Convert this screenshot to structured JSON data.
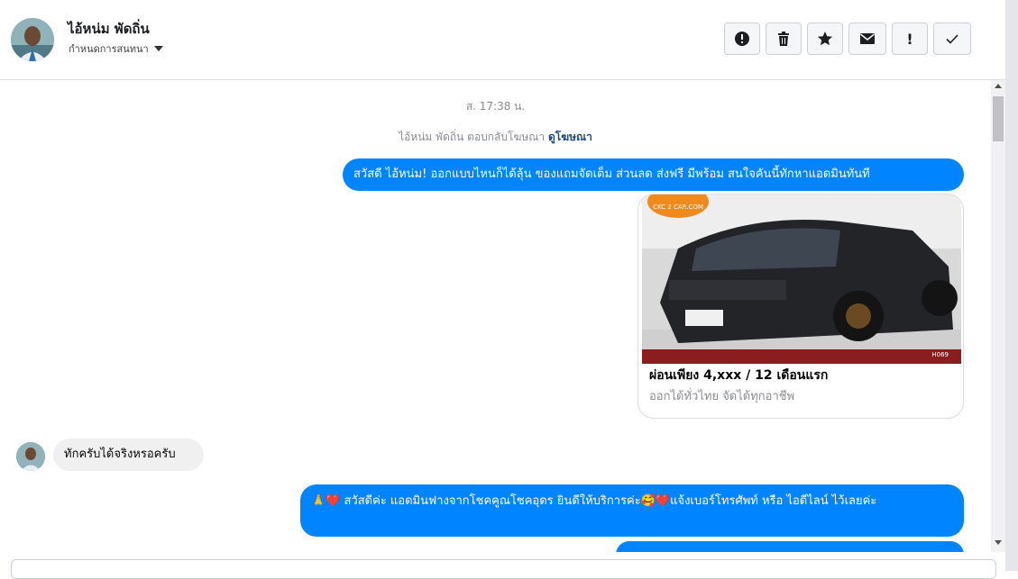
{
  "header": {
    "contact_name": "ไอ้หน่ม พัดถิ่น",
    "assign_label": "กำหนดการสนทนา"
  },
  "toolbar": {
    "spam_icon": "alert-circle-icon",
    "delete_icon": "trash-icon",
    "star_icon": "star-icon",
    "unread_icon": "envelope-icon",
    "important_label": "!",
    "done_icon": "check-icon"
  },
  "thread": {
    "timestamp": "ส. 17:38 น.",
    "ad_reply_text": "ไอ้หน่ม พัดถิ่น ตอบกลับโฆษณา",
    "ad_reply_link": "ดูโฆษณา",
    "messages": [
      {
        "from": "page",
        "text": "สวัสดี ไอ้หน่ม! ออกแบบไหนก็ได้ลุ้น ของแถมจัดเต็ม ส่วนลด ส่งฟรี มีพร้อม สนใจคันนี้ทักหาแอดมินทันที"
      },
      {
        "from": "page",
        "type": "ad_card",
        "title": "ผ่อนเพียง 4,xxx / 12 เดือนแรก",
        "subtitle": "ออกได้ทั่วไทย จัดได้ทุกอาชีพ",
        "image_label": "CKC 2 CAR.COM",
        "image_code": "H069"
      },
      {
        "from": "customer",
        "text": "ทักครับได้จริงหรอครับ"
      },
      {
        "from": "page",
        "text": "🙏❤️ สวัสดีค่ะ แอดมินฟางจากโชคคูณโชคอุดร ยินดีให้บริการค่ะ🥰❤️แจ้งเบอร์โทรศัพท์ หรือ ไอดีไลน์  ไว้เลยค่ะ"
      }
    ]
  },
  "colors": {
    "outgoing_bubble": "#0084ff",
    "incoming_bubble": "#f0f0f0",
    "link": "#1c4a85"
  }
}
